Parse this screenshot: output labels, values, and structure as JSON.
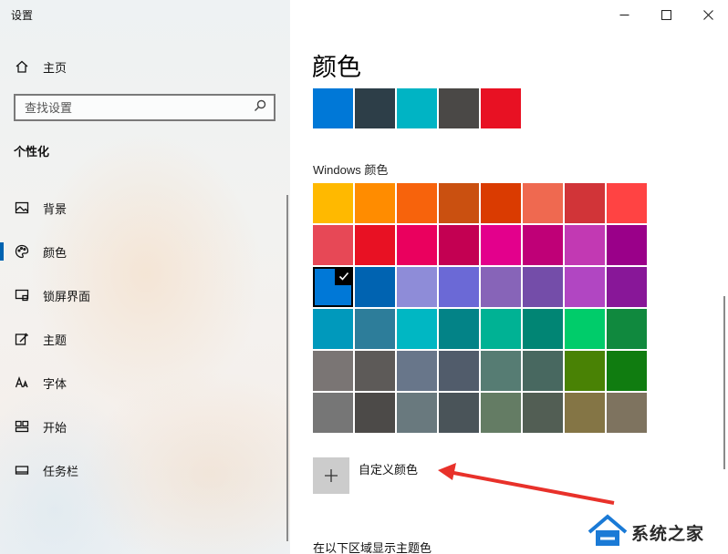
{
  "window": {
    "title": "设置"
  },
  "sidebar": {
    "home_label": "主页",
    "search_placeholder": "查找设置",
    "section_title": "个性化",
    "items": [
      {
        "label": "背景",
        "icon": "picture-icon"
      },
      {
        "label": "颜色",
        "icon": "palette-icon",
        "selected": true
      },
      {
        "label": "锁屏界面",
        "icon": "lock-screen-icon"
      },
      {
        "label": "主题",
        "icon": "theme-brush-icon"
      },
      {
        "label": "字体",
        "icon": "font-icon"
      },
      {
        "label": "开始",
        "icon": "start-tiles-icon"
      },
      {
        "label": "任务栏",
        "icon": "taskbar-icon"
      }
    ]
  },
  "main": {
    "title": "颜色",
    "recent_colors": [
      "#0078d7",
      "#2d3e48",
      "#00b4c4",
      "#4a4846",
      "#e81123"
    ],
    "windows_colors_label": "Windows 颜色",
    "windows_colors": [
      [
        "#ffb900",
        "#ff8c00",
        "#f7630c",
        "#ca5010",
        "#da3b01",
        "#ef6950",
        "#d13438",
        "#ff4343"
      ],
      [
        "#e74856",
        "#e81123",
        "#ea005e",
        "#c30052",
        "#e3008c",
        "#bf0077",
        "#c239b3",
        "#9a0089"
      ],
      [
        "#0078d7",
        "#0063b1",
        "#8e8cd8",
        "#6b69d6",
        "#8764b8",
        "#744da9",
        "#b146c2",
        "#881798"
      ],
      [
        "#0099bc",
        "#2d7d9a",
        "#00b7c3",
        "#038387",
        "#00b294",
        "#018574",
        "#00cc6a",
        "#10893e"
      ],
      [
        "#7a7574",
        "#5d5a58",
        "#68768a",
        "#515c6b",
        "#567c73",
        "#486860",
        "#498205",
        "#107c10"
      ],
      [
        "#767676",
        "#4c4a48",
        "#69797e",
        "#4a5459",
        "#647c64",
        "#525e54",
        "#847545",
        "#7e735f"
      ]
    ],
    "selected_color": "#0078d7",
    "custom_color_label": "自定义颜色",
    "bottom_heading": "在以下区域显示主题色"
  },
  "annotation": {
    "arrow_color": "#e8312a"
  },
  "watermark": {
    "text": "系统之家"
  }
}
